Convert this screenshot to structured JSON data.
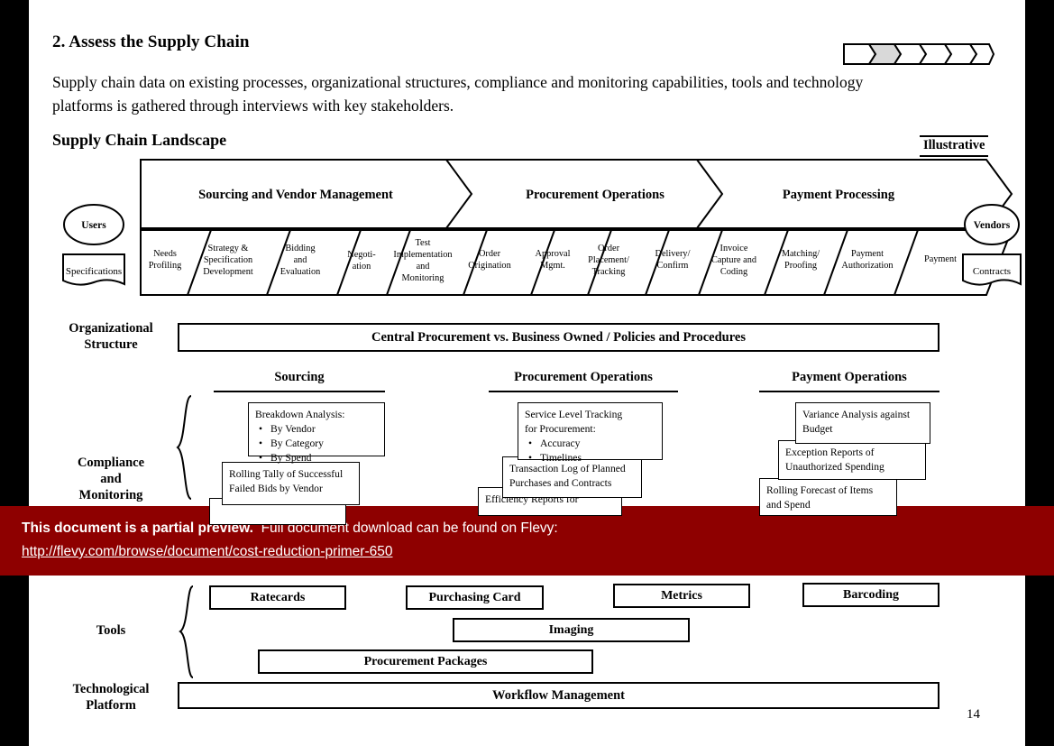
{
  "slide": {
    "title": "2. Assess the Supply Chain",
    "body": "Supply chain data on existing processes, organizational structures, compliance and monitoring capabilities, tools and technology platforms is gathered through interviews with key stakeholders.",
    "section_title": "Supply Chain Landscape",
    "illustrative_tag": "Illustrative",
    "page_number": "14"
  },
  "progress": {
    "total_segments": 6,
    "active_index": 2
  },
  "chain": {
    "start_node": "Users",
    "start_doc": "Specifications",
    "end_node": "Vendors",
    "end_doc": "Contracts",
    "bands": [
      {
        "label": "Sourcing and Vendor Management"
      },
      {
        "label": "Procurement Operations"
      },
      {
        "label": "Payment Processing"
      }
    ],
    "steps": [
      {
        "lines": [
          "Needs",
          "Profiling"
        ]
      },
      {
        "lines": [
          "Strategy &",
          "Specification",
          "Development"
        ]
      },
      {
        "lines": [
          "Bidding",
          "and",
          "Evaluation"
        ]
      },
      {
        "lines": [
          "Negoti-",
          "ation"
        ]
      },
      {
        "lines": [
          "Test",
          "Implementation",
          "and",
          "Monitoring"
        ]
      },
      {
        "lines": [
          "Order",
          "Origination"
        ]
      },
      {
        "lines": [
          "Approval",
          "Mgmt."
        ]
      },
      {
        "lines": [
          "Order",
          "Placement/",
          "Tracking"
        ]
      },
      {
        "lines": [
          "Delivery/",
          "Confirm"
        ]
      },
      {
        "lines": [
          "Invoice",
          "Capture and",
          "Coding"
        ]
      },
      {
        "lines": [
          "Matching/",
          "Proofing"
        ]
      },
      {
        "lines": [
          "Payment",
          "Authorization"
        ]
      },
      {
        "lines": [
          "Payment"
        ]
      }
    ]
  },
  "org_structure": {
    "row_label_line1": "Organizational",
    "row_label_line2": "Structure",
    "bar_text": "Central Procurement vs. Business Owned / Policies and Procedures"
  },
  "compliance": {
    "row_label_line1": "Compliance",
    "row_label_line2": "and",
    "row_label_line3": "Monitoring",
    "columns": [
      {
        "heading": "Sourcing",
        "boxes": [
          {
            "title": "Breakdown Analysis:",
            "bullets": [
              "By Vendor",
              "By Category",
              "By Spend"
            ]
          },
          {
            "title": "Rolling Tally of Successful\nFailed Bids by Vendor",
            "bullets": []
          },
          {
            "title": "",
            "bullets": []
          }
        ]
      },
      {
        "heading": "Procurement Operations",
        "boxes": [
          {
            "title": "Service Level Tracking\nfor Procurement:",
            "bullets": [
              "Accuracy",
              "Timelines"
            ]
          },
          {
            "title": "Transaction Log of Planned\nPurchases and Contracts",
            "bullets": []
          },
          {
            "title": "Efficiency Reports for",
            "bullets": []
          }
        ]
      },
      {
        "heading": "Payment Operations",
        "boxes": [
          {
            "title": "Variance Analysis against\nBudget",
            "bullets": []
          },
          {
            "title": "Exception Reports of\nUnauthorized Spending",
            "bullets": []
          },
          {
            "title": "Rolling Forecast of Items\nand Spend",
            "bullets": []
          }
        ]
      }
    ]
  },
  "tools": {
    "row_label": "Tools",
    "items": [
      {
        "label": "Ratecards"
      },
      {
        "label": "Purchasing Card"
      },
      {
        "label": "Metrics"
      },
      {
        "label": "Barcoding"
      },
      {
        "label": "Imaging"
      },
      {
        "label": "Procurement Packages"
      }
    ]
  },
  "technological_platform": {
    "row_label_line1": "Technological",
    "row_label_line2": "Platform",
    "bar_text": "Workflow Management"
  },
  "banner": {
    "bold_text": "This document is a partial preview.",
    "rest_text": "Full document download can be found on Flevy:",
    "url": "http://flevy.com/browse/document/cost-reduction-primer-650",
    "background_color": "#8e0000"
  }
}
